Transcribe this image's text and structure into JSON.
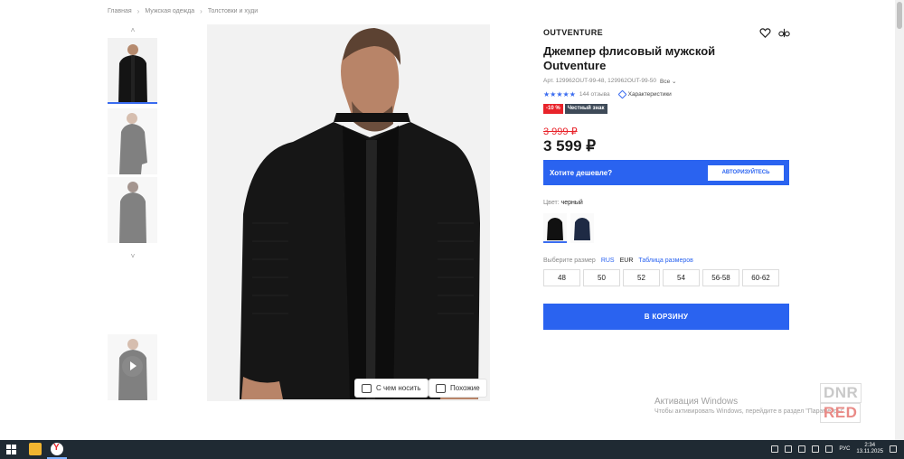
{
  "breadcrumb": [
    "Главная",
    "Мужская одежда",
    "Толстовки и худи"
  ],
  "product": {
    "brand": "OUTVENTURE",
    "title": "Джемпер флисовый мужской Outventure",
    "article": "Арт. 129962OUT-99-48, 129962OUT-99-50",
    "article_all": "Все",
    "stars": "★★★★★",
    "reviews": "144 отзыва",
    "characteristics": "Характеристики",
    "badge_discount": "-10 %",
    "badge_honest": "Честный знак",
    "old_price": "3 999 ₽",
    "price": "3 599 ₽"
  },
  "cheaper": {
    "text": "Хотите дешевле?",
    "button": "АВТОРИЗУЙТЕСЬ"
  },
  "color": {
    "label": "Цвет:",
    "value": "черный"
  },
  "size": {
    "label": "Выберите размер",
    "systems": [
      "RUS",
      "EUR"
    ],
    "table_link": "Таблица размеров",
    "options": [
      "48",
      "50",
      "52",
      "54",
      "56-58",
      "60-62"
    ]
  },
  "cart_button": "В КОРЗИНУ",
  "image_buttons": {
    "wear_with": "С чем носить",
    "similar": "Похожие"
  },
  "activation": {
    "title": "Активация Windows",
    "subtitle": "Чтобы активировать Windows, перейдите в раздел \"Параметры\"."
  },
  "watermark": {
    "line1": "DNR",
    "line2": "RED"
  },
  "taskbar": {
    "lang": "РУС",
    "time": "2:34",
    "date": "13.11.2025"
  },
  "colors": {
    "accent": "#2a63f0",
    "sale": "#e8232a",
    "taskbar": "#1f2a33"
  }
}
